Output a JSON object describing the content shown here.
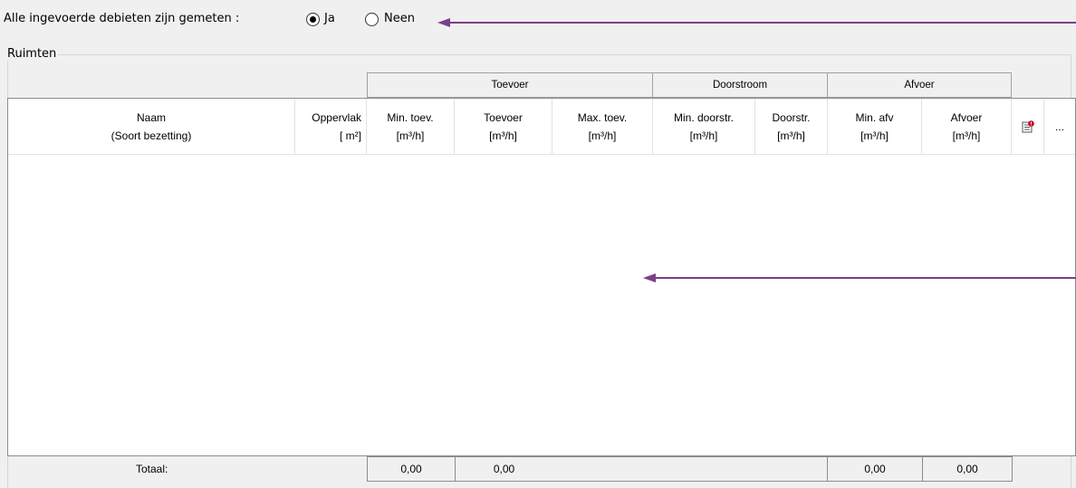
{
  "question": {
    "label": "Alle ingevoerde debieten zijn gemeten :",
    "options": [
      {
        "label": "Ja",
        "selected": true
      },
      {
        "label": "Neen",
        "selected": false
      }
    ]
  },
  "group_title": "Ruimten",
  "column_groups": [
    "Toevoer",
    "Doorstroom",
    "Afvoer"
  ],
  "columns": [
    {
      "line1": "Naam",
      "line2": "(Soort bezetting)"
    },
    {
      "line1": "Oppervlak",
      "line2": "[ m²]"
    },
    {
      "line1": "Min. toev.",
      "line2": "[m³/h]"
    },
    {
      "line1": "Toevoer",
      "line2": "[m³/h]"
    },
    {
      "line1": "Max. toev.",
      "line2": "[m³/h]"
    },
    {
      "line1": "Min. doorstr.",
      "line2": "[m³/h]"
    },
    {
      "line1": "Doorstr.",
      "line2": "[m³/h]"
    },
    {
      "line1": "Min. afv",
      "line2": "[m³/h]"
    },
    {
      "line1": "Afvoer",
      "line2": "[m³/h]"
    }
  ],
  "extra_columns": {
    "more_label": "..."
  },
  "totals": {
    "label": "Totaal:",
    "min_toev": "0,00",
    "toevoer": "0,00",
    "min_afv": "0,00",
    "afvoer": "0,00"
  },
  "colors": {
    "annotation_arrow": "#7b3f8c",
    "warning_badge": "#c0001a"
  },
  "icons": [
    "list-warning-icon",
    "annotation-arrow"
  ]
}
